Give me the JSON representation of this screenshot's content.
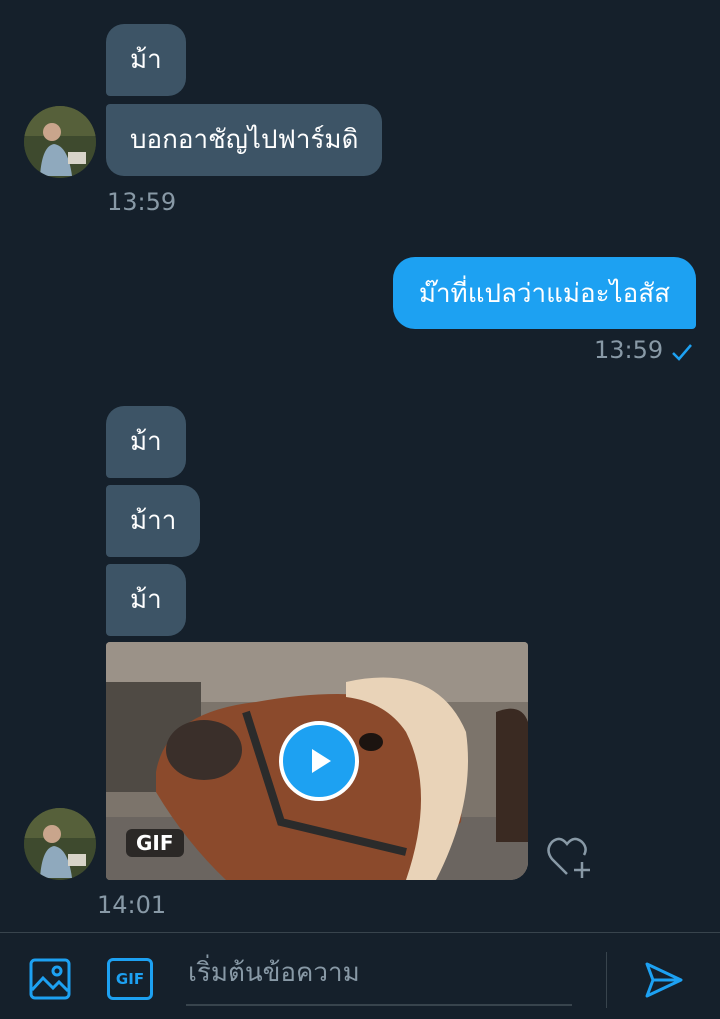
{
  "messages": {
    "m1": "ม้า",
    "m2": "บอกอาชัญไปฟาร์มดิ",
    "time1": "13:59",
    "out1": "ม๊าที่แปลว่าแม่อะไอสัส",
    "time2": "13:59",
    "m3": "ม้า",
    "m4": "ม้าา",
    "m5": "ม้า",
    "gif_badge": "GIF",
    "time3": "14:01"
  },
  "composer": {
    "placeholder": "เริ่มต้นข้อความ",
    "gif_label": "GIF"
  },
  "icons": {
    "read": "checkmark-icon",
    "like": "heart-plus-icon",
    "image": "image-icon",
    "gif": "gif-icon",
    "send": "send-icon",
    "play": "play-icon"
  },
  "colors": {
    "background": "#15202b",
    "incoming_bubble": "#3d5466",
    "outgoing_bubble": "#1da1f2",
    "accent": "#1da1f2",
    "muted_text": "#8899a6"
  }
}
